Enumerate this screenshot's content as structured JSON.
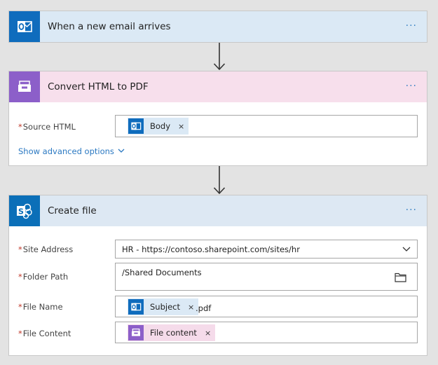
{
  "flow": {
    "trigger": {
      "title": "When a new email arrives",
      "menu": "···",
      "icon": "outlook-icon"
    },
    "convert": {
      "title": "Convert HTML to PDF",
      "menu": "···",
      "icon": "printer-tray-icon",
      "fields": {
        "source_html": {
          "required_mark": "*",
          "label": "Source HTML",
          "token": {
            "label": "Body",
            "remove": "×",
            "icon": "outlook-icon"
          }
        }
      },
      "advanced_link": "Show advanced options"
    },
    "create_file": {
      "title": "Create file",
      "menu": "···",
      "icon": "sharepoint-icon",
      "fields": {
        "site_address": {
          "required_mark": "*",
          "label": "Site Address",
          "value": "HR - https://contoso.sharepoint.com/sites/hr"
        },
        "folder_path": {
          "required_mark": "*",
          "label": "Folder Path",
          "value": "/Shared Documents"
        },
        "file_name": {
          "required_mark": "*",
          "label": "File Name",
          "token": {
            "label": "Subject",
            "remove": "×",
            "icon": "outlook-icon"
          },
          "suffix": ".pdf"
        },
        "file_content": {
          "required_mark": "*",
          "label": "File Content",
          "token": {
            "label": "File content",
            "remove": "×",
            "icon": "printer-tray-icon"
          }
        }
      }
    }
  },
  "colors": {
    "outlook_blue": "#0f6cbd",
    "convert_purple": "#8c5fc9",
    "sharepoint_blue": "#0b6fb8",
    "link_blue": "#2b79c2",
    "required_red": "#c0392b"
  }
}
